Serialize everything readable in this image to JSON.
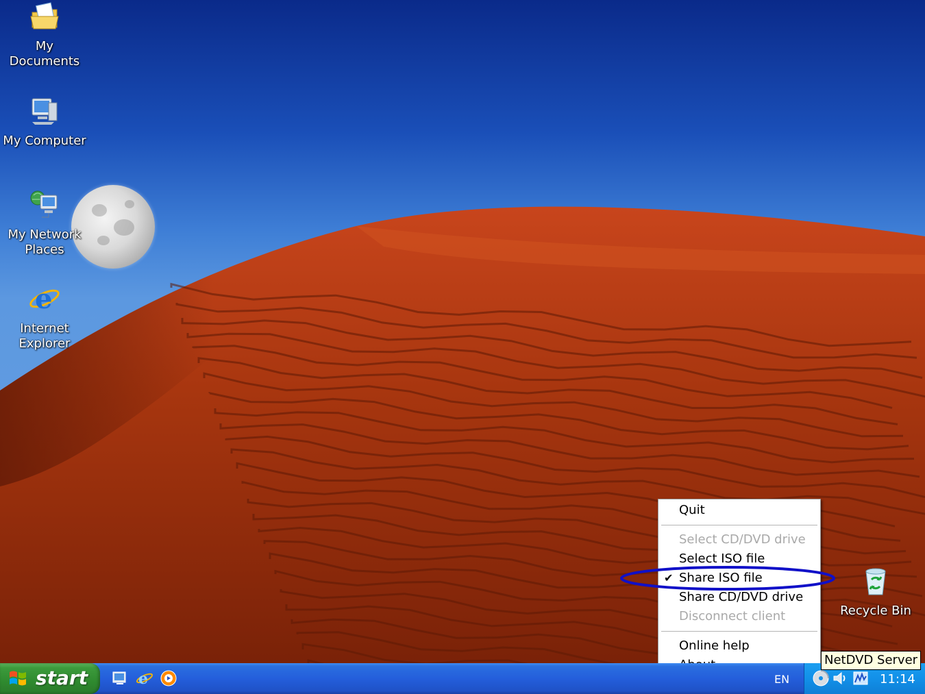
{
  "desktop": {
    "icons": [
      {
        "label_lines": [
          "My Documents"
        ],
        "icon": "folder-document-icon"
      },
      {
        "label_lines": [
          "My Computer"
        ],
        "icon": "computer-icon"
      },
      {
        "label_lines": [
          "My Network",
          "Places"
        ],
        "icon": "network-places-icon"
      },
      {
        "label_lines": [
          "Internet",
          "Explorer"
        ],
        "icon": "internet-explorer-icon"
      },
      {
        "label_lines": [
          "Recycle Bin"
        ],
        "icon": "recycle-bin-icon"
      }
    ]
  },
  "context_menu": {
    "items": [
      {
        "label": "Quit",
        "enabled": true,
        "checked": false
      },
      {
        "label": "Select CD/DVD drive",
        "enabled": false,
        "checked": false
      },
      {
        "label": "Select ISO file",
        "enabled": true,
        "checked": false
      },
      {
        "label": "Share ISO file",
        "enabled": true,
        "checked": true,
        "check_glyph": "✔"
      },
      {
        "label": "Share CD/DVD drive",
        "enabled": true,
        "checked": false
      },
      {
        "label": "Disconnect client",
        "enabled": false,
        "checked": false
      },
      {
        "label": "Online help",
        "enabled": true,
        "checked": false
      },
      {
        "label": "About",
        "enabled": true,
        "checked": false
      }
    ],
    "highlight_color": "#1010c8"
  },
  "tooltip": {
    "text": "NetDVD Server"
  },
  "taskbar": {
    "start_label": "start",
    "quick_launch": [
      "show-desktop-icon",
      "internet-explorer-icon",
      "media-player-icon"
    ],
    "language": "EN",
    "tray_icons": [
      "netdvd-disc-icon",
      "volume-icon",
      "monitor-tray-icon"
    ],
    "clock": "11:14",
    "colors": {
      "taskbar": "#245edb",
      "start": "#3c9b3c",
      "tray": "#1290e8"
    }
  }
}
